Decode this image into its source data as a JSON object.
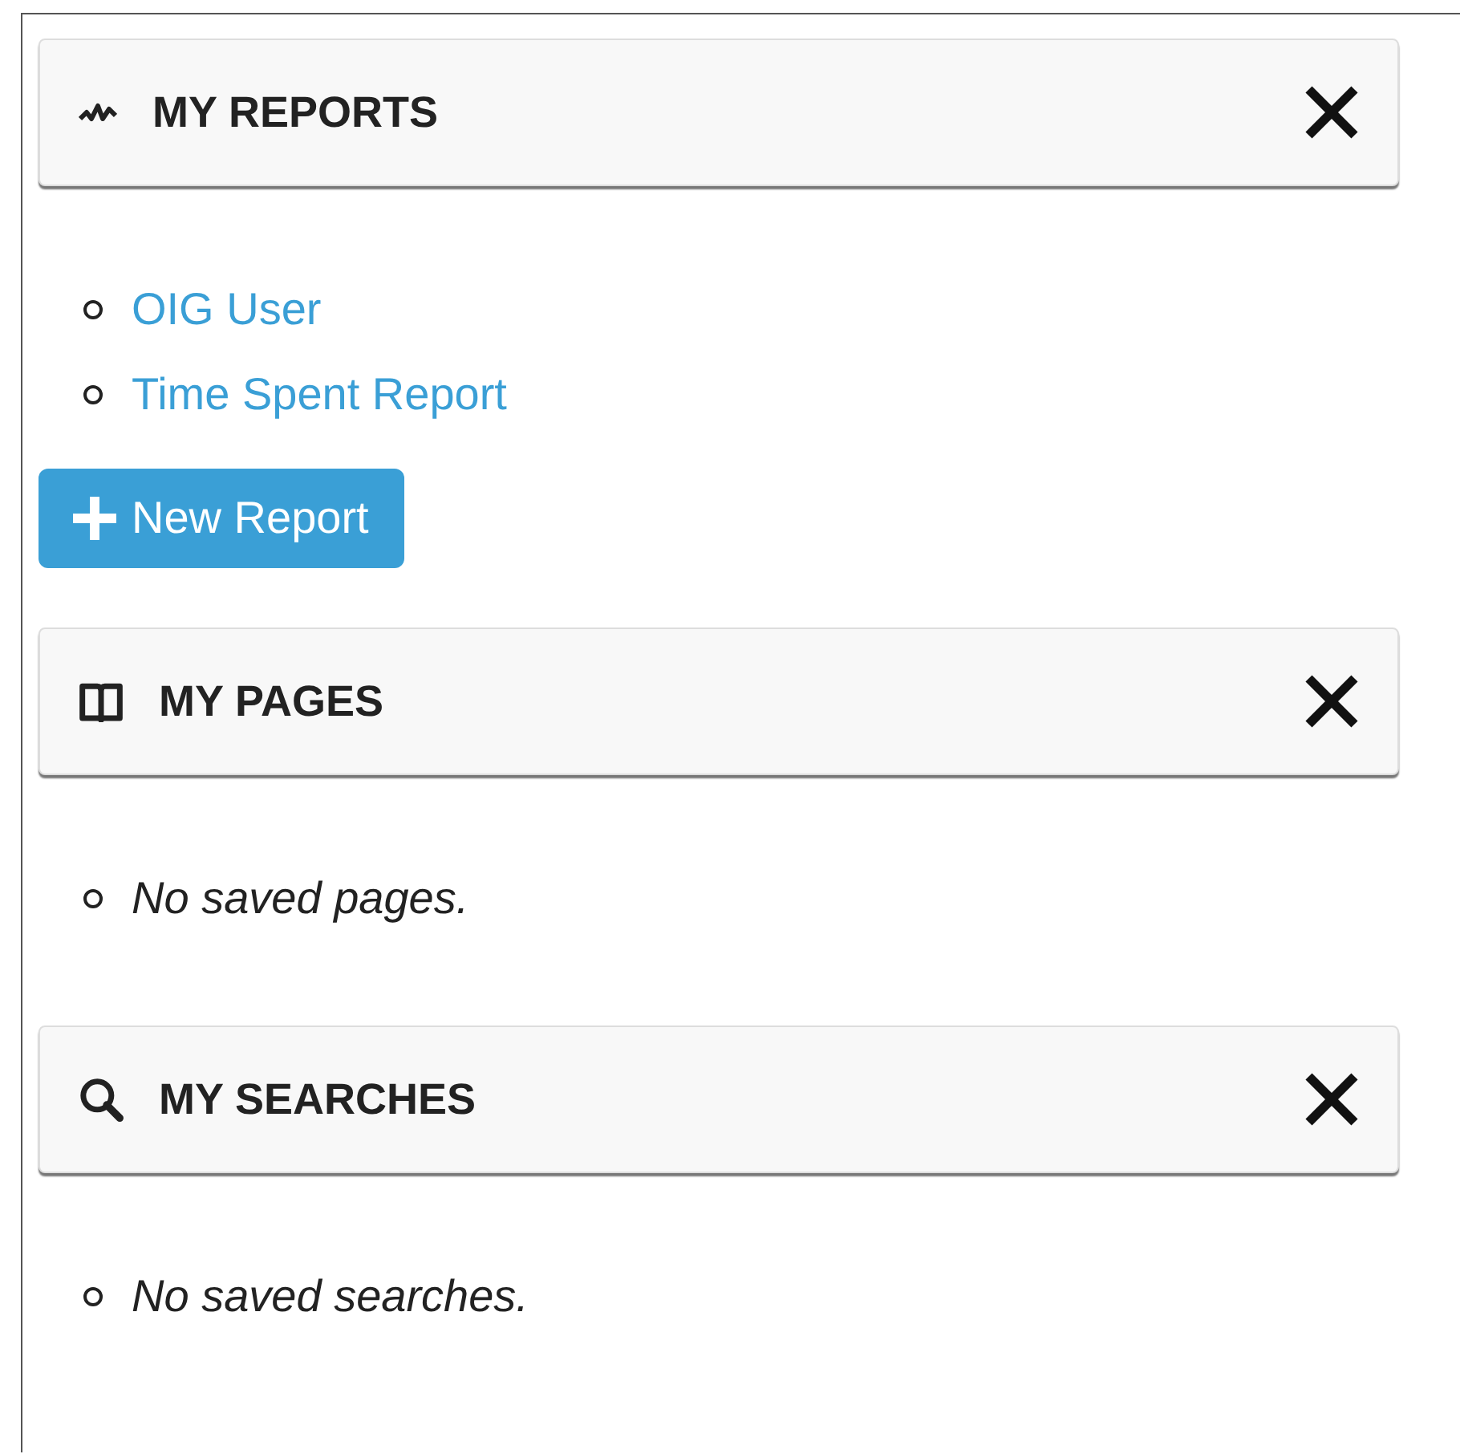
{
  "sections": [
    {
      "title": "MY REPORTS",
      "kind": "reports",
      "items": [
        {
          "kind": "link",
          "text": "OIG User"
        },
        {
          "kind": "link",
          "text": "Time Spent Report"
        }
      ],
      "button": {
        "label": "New Report"
      }
    },
    {
      "title": "MY PAGES",
      "kind": "pages",
      "items": [
        {
          "kind": "empty",
          "text": "No saved pages."
        }
      ]
    },
    {
      "title": "MY SEARCHES",
      "kind": "searches",
      "items": [
        {
          "kind": "empty",
          "text": "No saved searches."
        }
      ]
    }
  ]
}
